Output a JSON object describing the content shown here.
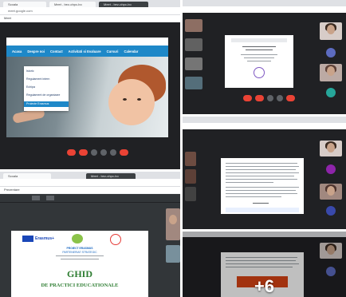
{
  "tile1": {
    "tabs": [
      "Scoala",
      "Meet - bez-ohpc-bo",
      "Meet - bez-ohpc-bo"
    ],
    "url": "meet.google.com",
    "meet_bar": "Meet",
    "nav": [
      "Acasa",
      "Despre noi",
      "Contact",
      "Activitati si Evaluare",
      "Cursuri",
      "Calendar"
    ],
    "dropdown": [
      "Istoric",
      "Regulament intern",
      "Echipa",
      "Regulament de organizare",
      "Proiecte Erasmus"
    ]
  },
  "tile4": {
    "tabs": [
      "Scoala",
      "Meet - bez-ohpc-bo"
    ],
    "url": "Prezentare",
    "logo_left": "Erasmus+",
    "doc_lines": [
      "PROIECT ERASMUS",
      "PARTENERIAT STRATEGIC"
    ],
    "ghid": "GHID",
    "ghid_sub": "DE PRACTICI EDUCATIONALE"
  },
  "more_overlay": "+6",
  "colors": {
    "nav_blue": "#1e88c8",
    "meet_dark": "#202124",
    "end_call_red": "#ea4335"
  }
}
